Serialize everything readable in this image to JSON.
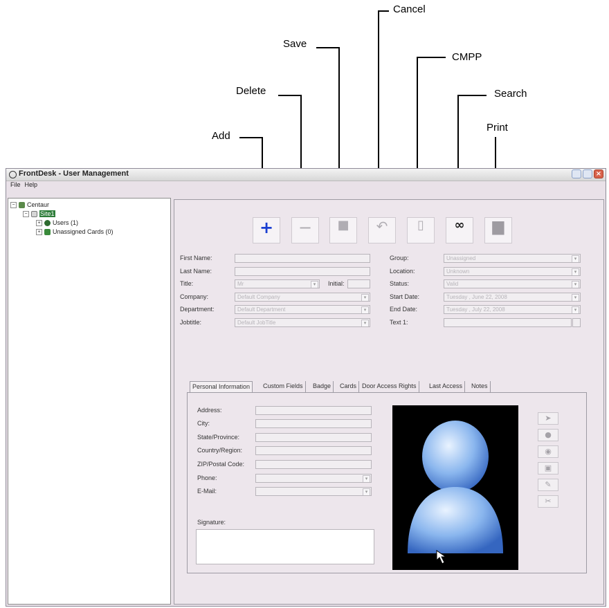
{
  "callouts": {
    "cancel": "Cancel",
    "save": "Save",
    "cmpp": "CMPP",
    "delete": "Delete",
    "search": "Search",
    "print": "Print",
    "add": "Add"
  },
  "window": {
    "title": "FrontDesk - User Management",
    "menu": [
      "File",
      "Help"
    ]
  },
  "tree": {
    "root": "Centaur",
    "site": "Site1",
    "users": "Users (1)",
    "unassigned": "Unassigned Cards (0)"
  },
  "toolbar": {
    "add_icon": "plus-icon",
    "delete_icon": "minus-icon",
    "save_icon": "disk-icon",
    "cancel_icon": "undo-arrow-icon",
    "cmpp_icon": "document-icon",
    "search_icon": "binoculars-icon",
    "print_icon": "printer-icon",
    "add_color": "#1a3fd1"
  },
  "form": {
    "first_name_label": "First Name:",
    "last_name_label": "Last Name:",
    "title_label": "Title:",
    "title_value": "Mr",
    "initial_label": "Initial:",
    "company_label": "Company:",
    "company_value": "Default Company",
    "department_label": "Department:",
    "department_value": "Default Department",
    "jobtitle_label": "Jobtitle:",
    "jobtitle_value": "Default JobTitle",
    "group_label": "Group:",
    "group_value": "Unassigned",
    "location_label": "Location:",
    "location_value": "Unknown",
    "status_label": "Status:",
    "status_value": "Valid",
    "start_date_label": "Start Date:",
    "start_date_value": "Tuesday , June 22, 2008",
    "end_date_label": "End Date:",
    "end_date_value": "Tuesday , July 22, 2008",
    "text1_label": "Text 1:"
  },
  "tabs": [
    "Personal Information",
    "Custom Fields",
    "Badge",
    "Cards",
    "Door Access Rights",
    "Last Access",
    "Notes"
  ],
  "personal": {
    "address_label": "Address:",
    "city_label": "City:",
    "state_label": "State/Province:",
    "country_label": "Country/Region:",
    "zip_label": "ZIP/Postal Code:",
    "phone_label": "Phone:",
    "email_label": "E-Mail:",
    "signature_label": "Signature:"
  },
  "photo_tools": [
    "paste-icon",
    "camera-icon",
    "capture-icon",
    "crop-icon",
    "edit-pen-icon",
    "clear-icon"
  ]
}
